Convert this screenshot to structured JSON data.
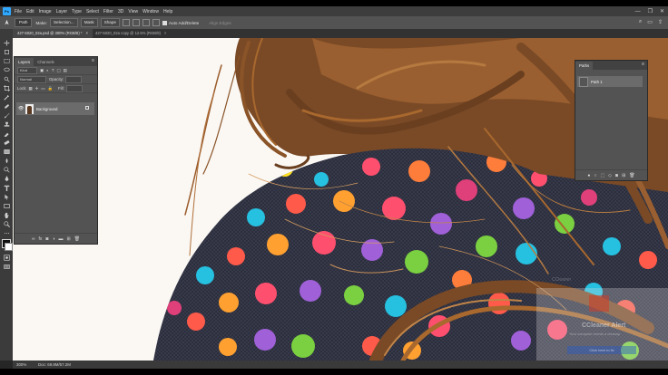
{
  "app": {
    "logo": "Ps",
    "accent": "#31a8ff"
  },
  "menu": [
    "File",
    "Edit",
    "Image",
    "Layer",
    "Type",
    "Select",
    "Filter",
    "3D",
    "View",
    "Window",
    "Help"
  ],
  "window_controls": [
    "—",
    "❐",
    "✕"
  ],
  "options": {
    "mode": "Path",
    "make_label": "Make:",
    "selection": "Selection...",
    "mask": "Mask",
    "shape": "Shape",
    "auto_add_delete": "Auto Add/Delete",
    "align_edges": "Align Edges"
  },
  "tabs": [
    {
      "label": "427-5020_02a.psd @ 300% (RGB/8) *",
      "close": "×"
    },
    {
      "label": "427-5020_02a copy @ 12.5% (RGB/8)",
      "close": "×"
    }
  ],
  "layers_panel": {
    "tabs": [
      "Layers",
      "Channels"
    ],
    "menu": "≡",
    "kind": "Kind",
    "blend": "Normal",
    "opacity_label": "Opacity:",
    "lock_label": "Lock:",
    "fill_label": "Fill:",
    "layer": {
      "name": "Background",
      "visible": "👁"
    },
    "footer_icons": [
      "link-icon",
      "fx-icon",
      "mask-icon",
      "adjustment-icon",
      "folder-icon",
      "new-layer-icon",
      "trash-icon"
    ]
  },
  "paths_panel": {
    "title": "Paths",
    "menu": "≡",
    "path": {
      "name": "Path 1"
    }
  },
  "status": {
    "zoom": "300%",
    "doc": "Doc: 69.8M/57.2M"
  },
  "alert": {
    "title": "CCleaner Alert",
    "body": "Your computer needs a cleanup",
    "button": "Click here to fix",
    "watermark": "CCleaner"
  }
}
